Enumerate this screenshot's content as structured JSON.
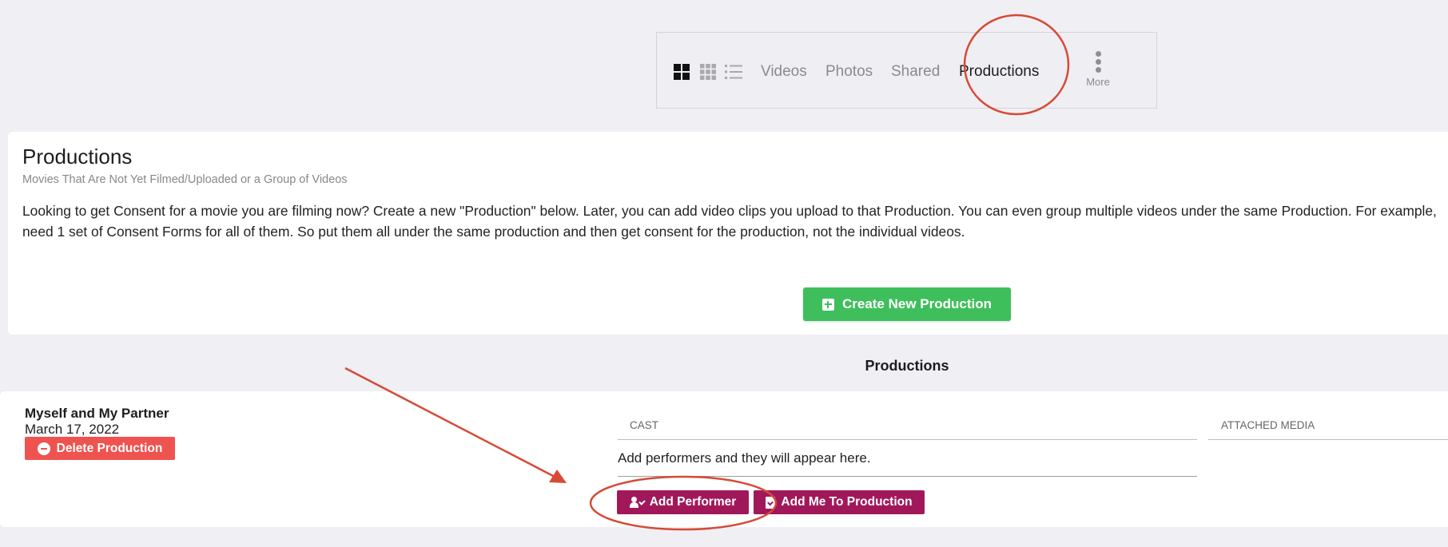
{
  "toolbar": {
    "view_icons": [
      "grid-large-icon",
      "grid-small-icon",
      "list-icon"
    ],
    "tabs": [
      {
        "label": "Videos",
        "active": false
      },
      {
        "label": "Photos",
        "active": false
      },
      {
        "label": "Shared",
        "active": false
      },
      {
        "label": "Productions",
        "active": true
      }
    ],
    "more_label": "More"
  },
  "intro": {
    "title": "Productions",
    "subtitle": "Movies That Are Not Yet Filmed/Uploaded or a Group of Videos",
    "description": "Looking to get Consent for a movie you are filming now? Create a new \"Production\" below. Later, you can add video clips you upload to that Production. You can even group multiple videos under the same Production. For example, need 1 set of Consent Forms for all of them. So put them all under the same production and then get consent for the production, not the individual videos.",
    "create_button": "Create New Production"
  },
  "list_title": "Productions",
  "production": {
    "name": "Myself and My Partner",
    "date": "March 17, 2022",
    "delete_button": "Delete Production",
    "cast_header": "CAST",
    "media_header": "ATTACHED MEDIA",
    "cast_empty": "Add performers and they will appear here.",
    "add_performer_button": "Add Performer",
    "add_me_button": "Add Me To Production"
  },
  "colors": {
    "background": "#f0eff4",
    "create_green": "#3fbf5c",
    "delete_red": "#ef5350",
    "action_purple": "#a0185a",
    "annotation_red": "#d64a36"
  }
}
